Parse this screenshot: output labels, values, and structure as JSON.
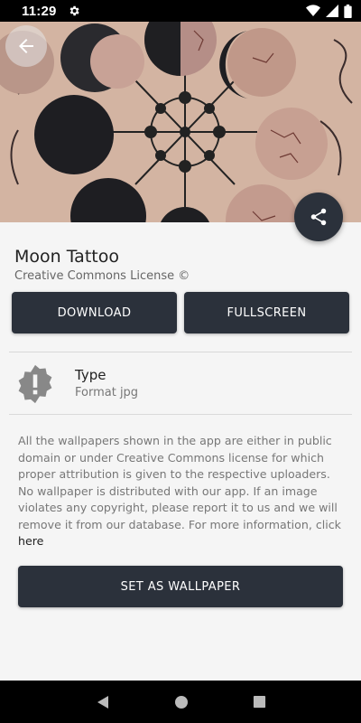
{
  "status_bar": {
    "time": "11:29",
    "icons": [
      "gear-icon",
      "wifi-icon",
      "signal-icon",
      "battery-icon"
    ]
  },
  "hero": {
    "description_icon": "moon-tattoo-image",
    "back_icon": "arrow-left-icon",
    "share_icon": "share-icon"
  },
  "wallpaper": {
    "title": "Moon Tattoo",
    "license": "Creative Commons License ©"
  },
  "actions": {
    "download_label": "DOWNLOAD",
    "fullscreen_label": "FULLSCREEN",
    "set_wallpaper_label": "SET AS WALLPAPER"
  },
  "type_info": {
    "label": "Type",
    "value": "Format jpg",
    "icon": "alert-badge-icon"
  },
  "disclaimer": {
    "text": "All the wallpapers shown in the app are either in public domain or under Creative Commons license for which proper attribution is given to the respective uploaders. No wallpaper is distributed with our app. If an image violates any copyright, please report it to us and we will remove it from our database. For more information, click ",
    "link": "here"
  },
  "colors": {
    "primary": "#2b313b",
    "background": "#f5f5f5"
  }
}
